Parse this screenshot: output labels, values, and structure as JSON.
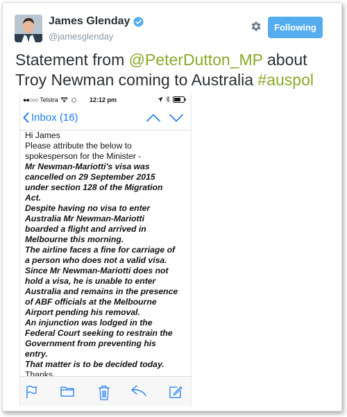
{
  "author": {
    "name": "James Glenday",
    "handle": "@jamesglenday",
    "verified": true
  },
  "follow_button": {
    "label": "Following",
    "color": "#55acee"
  },
  "tweet": {
    "part1": "Statement from ",
    "mention": "@PeterDutton_MP",
    "part2": " about Troy Newman coming to Australia ",
    "hashtag": "#auspol",
    "link_color": "#8aa827"
  },
  "phone": {
    "status_bar": {
      "carrier": "Telstra",
      "time": "12:12 pm"
    },
    "nav": {
      "back_label": "Inbox (16)"
    },
    "email": {
      "lines": [
        {
          "text": "Hi James",
          "bold": false
        },
        {
          "text": "Please attribute the below to",
          "bold": false
        },
        {
          "text": "spokesperson for the Minister -",
          "bold": false
        },
        {
          "text": "Mr Newman-Mariotti's visa was",
          "bold": true
        },
        {
          "text": "cancelled on 29 September 2015",
          "bold": true
        },
        {
          "text": "under section 128 of the Migration",
          "bold": true
        },
        {
          "text": "Act.",
          "bold": true
        },
        {
          "text": "Despite having no visa to enter",
          "bold": true
        },
        {
          "text": "Australia Mr Newman-Mariotti",
          "bold": true
        },
        {
          "text": "boarded a flight and arrived in",
          "bold": true
        },
        {
          "text": "Melbourne this morning.",
          "bold": true
        },
        {
          "text": "The airline faces a fine for carriage of",
          "bold": true
        },
        {
          "text": "a person who does not a valid visa.",
          "bold": true
        },
        {
          "text": "Since Mr Newman-Mariotti does not",
          "bold": true
        },
        {
          "text": "hold a visa, he is unable to enter",
          "bold": true
        },
        {
          "text": "Australia and remains in the presence",
          "bold": true
        },
        {
          "text": "of ABF officials at the Melbourne",
          "bold": true
        },
        {
          "text": "Airport pending his removal.",
          "bold": true
        },
        {
          "text": "An injunction was lodged in the",
          "bold": true
        },
        {
          "text": "Federal Court seeking to restrain the",
          "bold": true
        },
        {
          "text": "Government from preventing his",
          "bold": true
        },
        {
          "text": "entry.",
          "bold": true
        },
        {
          "text": "That matter is to be decided today.",
          "bold": true
        },
        {
          "text": "Thanks",
          "bold": false
        }
      ]
    },
    "toolbar": [
      "flag-icon",
      "folder-icon",
      "trash-icon",
      "reply-icon",
      "compose-icon"
    ],
    "accent_color": "#1a7cf5"
  }
}
